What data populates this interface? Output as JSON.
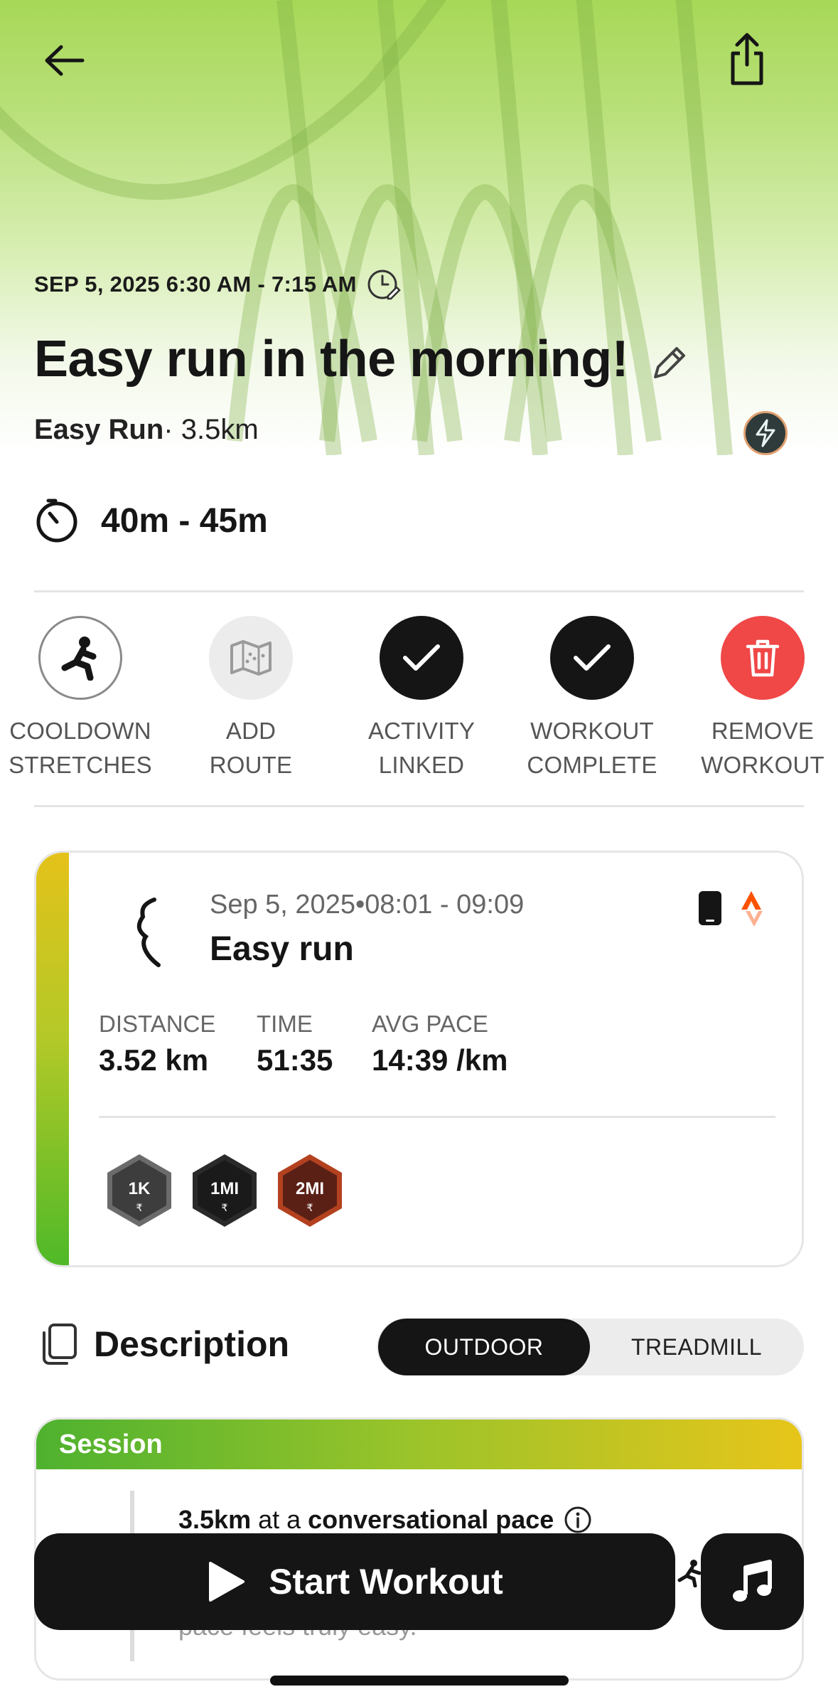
{
  "header": {
    "back_icon": "arrow-left-icon",
    "share_icon": "share-icon",
    "date_range": "SEP 5, 2025  6:30 AM - 7:15 AM",
    "title": "Easy run in the morning!",
    "workout_type": "Easy Run",
    "distance": "· 3.5km",
    "duration": "40m - 45m"
  },
  "actions": [
    {
      "line1": "COOLDOWN",
      "line2": "STRETCHES"
    },
    {
      "line1": "ADD",
      "line2": "ROUTE"
    },
    {
      "line1": "ACTIVITY",
      "line2": "LINKED"
    },
    {
      "line1": "WORKOUT",
      "line2": "COMPLETE"
    },
    {
      "line1": "REMOVE",
      "line2": "WORKOUT"
    }
  ],
  "activity": {
    "date": "Sep 5, 2025•08:01 - 09:09",
    "name": "Easy run",
    "stats": [
      {
        "label": "DISTANCE",
        "value": "3.52 km"
      },
      {
        "label": "TIME",
        "value": "51:35"
      },
      {
        "label": "AVG PACE",
        "value": "14:39 /km"
      }
    ],
    "badges": [
      "1K",
      "1MI",
      "2MI"
    ]
  },
  "description": {
    "title": "Description",
    "toggle": {
      "selected": "OUTDOOR",
      "other": "TREADMILL"
    }
  },
  "session": {
    "title": "Session",
    "line_bold1": "3.5km",
    "line_mid": " at a ",
    "line_bold2": "conversational pace",
    "line2": "pace feels truly easy."
  },
  "footer": {
    "start_label": "Start Workout",
    "music_icon": "music-note-icon"
  },
  "colors": {
    "accent_green": "#a7d857",
    "remove_red": "#f04747",
    "dark": "#151515"
  }
}
